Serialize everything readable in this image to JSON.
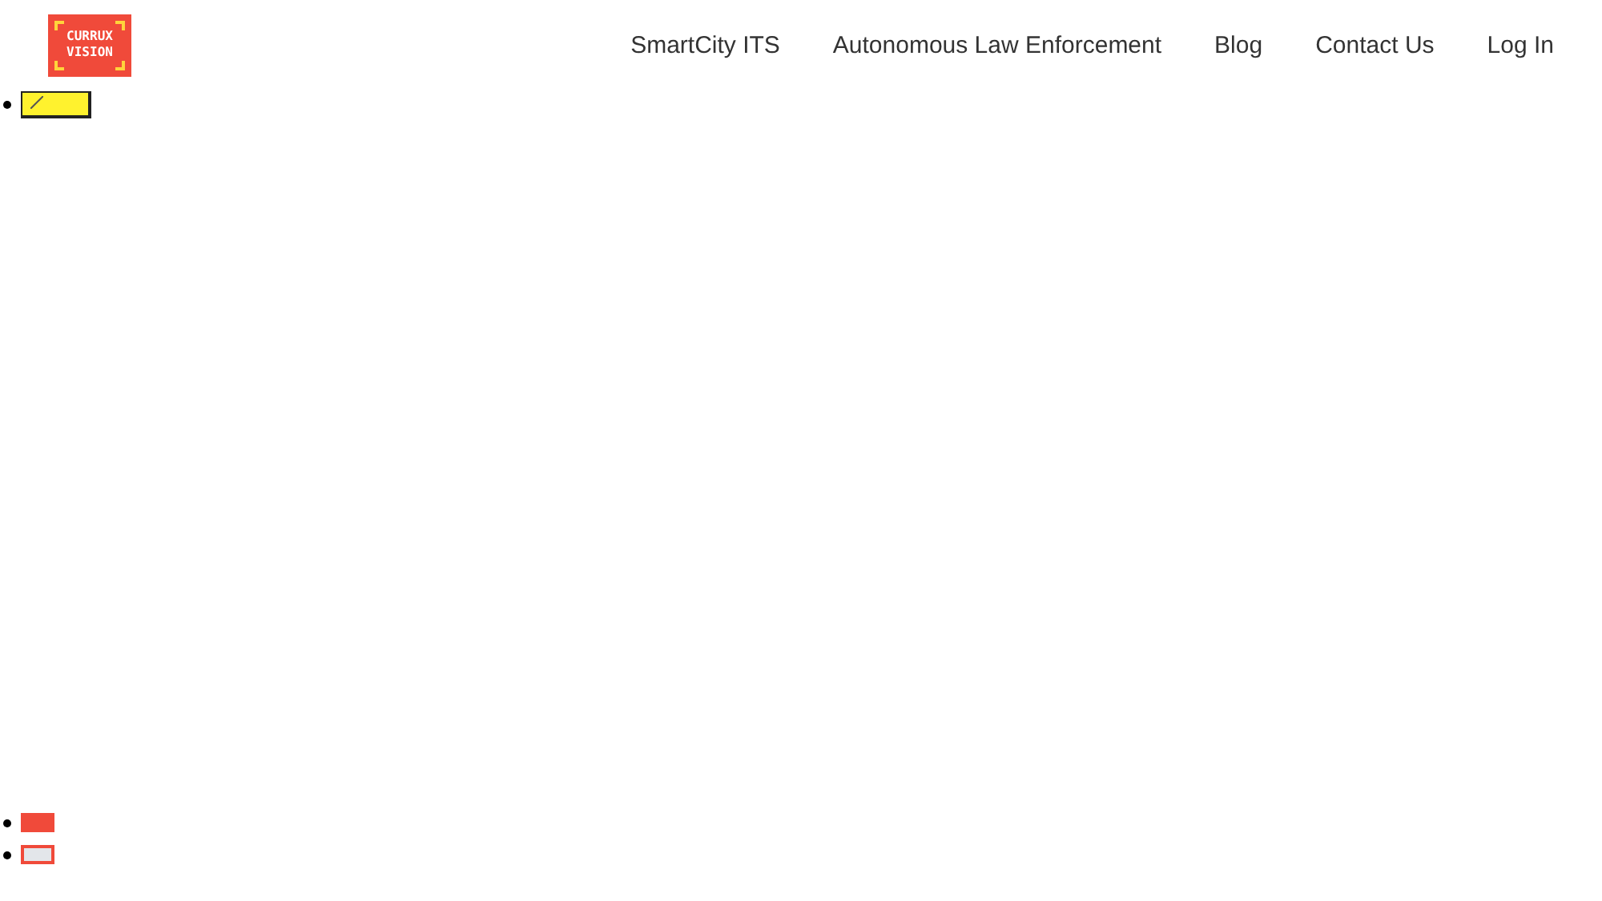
{
  "logo": {
    "lines": [
      "CURRUX",
      "VISION"
    ]
  },
  "nav": [
    {
      "label": "SmartCity ITS"
    },
    {
      "label": "Autonomous Law Enforcement"
    },
    {
      "label": "Blog"
    },
    {
      "label": "Contact Us"
    },
    {
      "label": "Log In"
    }
  ],
  "carousel_dots": [
    {
      "selected": true
    },
    {
      "selected": false
    }
  ]
}
